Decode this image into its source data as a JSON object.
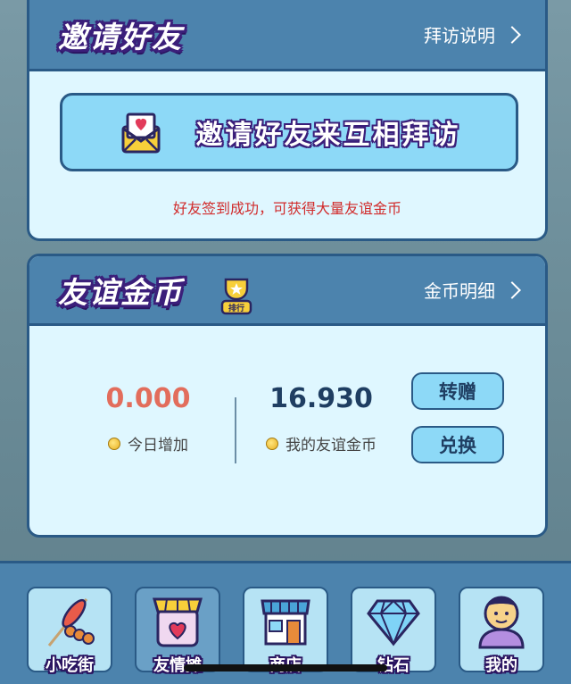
{
  "invite_card": {
    "title": "邀请好友",
    "help_link": "拜访说明",
    "invite_button": "邀请好友来互相拜访",
    "note": "好友签到成功，可获得大量友谊金币"
  },
  "coins_card": {
    "title": "友谊金币",
    "rank_badge": "排行",
    "detail_link": "金币明细",
    "today": {
      "value": "0.000",
      "label": "今日增加",
      "color": "#e26d5c"
    },
    "mine": {
      "value": "16.930",
      "label": "我的友谊金币",
      "color": "#1f3e62"
    },
    "transfer_button": "转赠",
    "exchange_button": "兑换"
  },
  "bottom_nav": {
    "items": [
      {
        "label": "小吃街",
        "icon": "food-skewer-icon"
      },
      {
        "label": "友情摊",
        "icon": "friendship-stall-icon",
        "active": true
      },
      {
        "label": "商店",
        "icon": "shop-icon"
      },
      {
        "label": "钻石",
        "icon": "diamond-icon"
      },
      {
        "label": "我的",
        "icon": "avatar-icon"
      }
    ]
  },
  "colors": {
    "header_bg": "#4c83ad",
    "card_bg": "#dff7ff",
    "border": "#2a5a86",
    "button_bg": "#8dd9f7",
    "note_red": "#d12b2b"
  }
}
